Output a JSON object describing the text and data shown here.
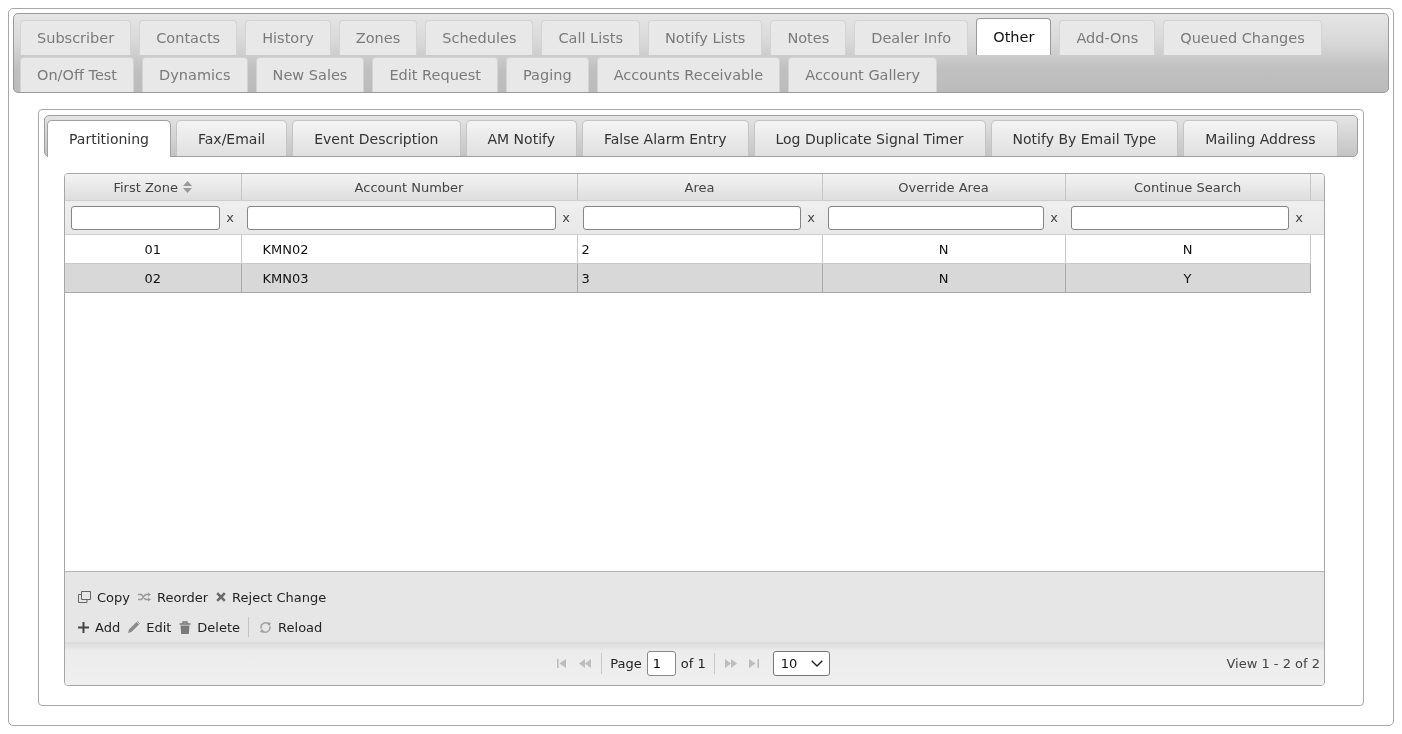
{
  "main_tab_rows": [
    {
      "tabs": [
        {
          "label": "Subscriber",
          "selected": false
        },
        {
          "label": "Contacts",
          "selected": false
        },
        {
          "label": "History",
          "selected": false
        },
        {
          "label": "Zones",
          "selected": false
        },
        {
          "label": "Schedules",
          "selected": false
        },
        {
          "label": "Call Lists",
          "selected": false
        },
        {
          "label": "Notify Lists",
          "selected": false
        },
        {
          "label": "Notes",
          "selected": false
        },
        {
          "label": "Dealer Info",
          "selected": false
        },
        {
          "label": "Other",
          "selected": true
        },
        {
          "label": "Add-Ons",
          "selected": false
        },
        {
          "label": "Queued Changes",
          "selected": false
        }
      ]
    },
    {
      "tabs": [
        {
          "label": "On/Off Test",
          "selected": false
        },
        {
          "label": "Dynamics",
          "selected": false
        },
        {
          "label": "New Sales",
          "selected": false
        },
        {
          "label": "Edit Request",
          "selected": false
        },
        {
          "label": "Paging",
          "selected": false
        },
        {
          "label": "Accounts Receivable",
          "selected": false
        },
        {
          "label": "Account Gallery",
          "selected": false
        }
      ]
    }
  ],
  "sub_tabs": [
    {
      "label": "Partitioning",
      "selected": true
    },
    {
      "label": "Fax/Email",
      "selected": false
    },
    {
      "label": "Event Description",
      "selected": false
    },
    {
      "label": "AM Notify",
      "selected": false
    },
    {
      "label": "False Alarm Entry",
      "selected": false
    },
    {
      "label": "Log Duplicate Signal Timer",
      "selected": false
    },
    {
      "label": "Notify By Email Type",
      "selected": false
    },
    {
      "label": "Mailing Address",
      "selected": false
    }
  ],
  "grid": {
    "columns": [
      {
        "label": "First Zone",
        "sortable": true,
        "filter_clear": "x"
      },
      {
        "label": "Account Number",
        "sortable": false,
        "filter_clear": "x"
      },
      {
        "label": "Area",
        "sortable": false,
        "filter_clear": "x"
      },
      {
        "label": "Override Area",
        "sortable": false,
        "filter_clear": "x"
      },
      {
        "label": "Continue Search",
        "sortable": false,
        "filter_clear": "x"
      }
    ],
    "rows": [
      {
        "cells": [
          "01",
          "KMN02",
          "2",
          "N",
          "N"
        ],
        "selected": false
      },
      {
        "cells": [
          "02",
          "KMN03",
          "3",
          "N",
          "Y"
        ],
        "selected": true
      }
    ],
    "toolbar_rows": [
      {
        "actions": [
          {
            "kind": "copy",
            "label": "Copy",
            "separator_before": false
          },
          {
            "kind": "reorder",
            "label": "Reorder",
            "separator_before": false
          },
          {
            "kind": "reject",
            "label": "Reject Change",
            "separator_before": false
          }
        ]
      },
      {
        "actions": [
          {
            "kind": "add",
            "label": "Add",
            "separator_before": false
          },
          {
            "kind": "edit",
            "label": "Edit",
            "separator_before": false
          },
          {
            "kind": "delete",
            "label": "Delete",
            "separator_before": false
          },
          {
            "kind": "reload",
            "label": "Reload",
            "separator_before": true
          }
        ]
      }
    ],
    "pager": {
      "nav_before": [
        {
          "kind": "first",
          "disabled": true
        },
        {
          "kind": "prev",
          "disabled": true
        }
      ],
      "page_label": "Page",
      "page_value": "1",
      "page_total": "of 1",
      "nav_after": [
        {
          "kind": "next",
          "disabled": true
        },
        {
          "kind": "last",
          "disabled": true
        }
      ],
      "page_size": "10",
      "summary": "View 1 - 2 of 2"
    }
  }
}
